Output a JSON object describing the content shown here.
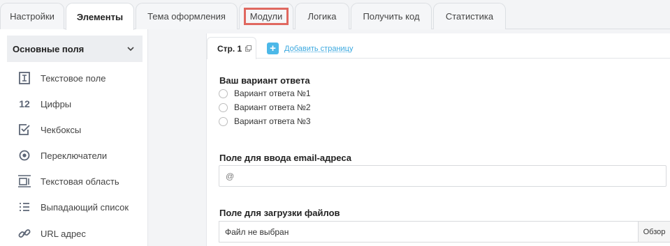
{
  "tabs": [
    {
      "label": "Настройки"
    },
    {
      "label": "Элементы"
    },
    {
      "label": "Тема оформления"
    },
    {
      "label": "Модули"
    },
    {
      "label": "Логика"
    },
    {
      "label": "Получить код"
    },
    {
      "label": "Статистика"
    }
  ],
  "active_tab": "Элементы",
  "highlight_color": "#e06860",
  "sidebar": {
    "section_title": "Основные поля",
    "items": [
      {
        "label": "Текстовое поле",
        "icon": "text-field-icon"
      },
      {
        "label": "Цифры",
        "icon": "numbers-icon",
        "icon_text": "12"
      },
      {
        "label": "Чекбоксы",
        "icon": "checkbox-icon"
      },
      {
        "label": "Переключатели",
        "icon": "radio-icon"
      },
      {
        "label": "Текстовая область",
        "icon": "textarea-icon"
      },
      {
        "label": "Выпадающий список",
        "icon": "list-icon"
      },
      {
        "label": "URL адрес",
        "icon": "link-icon"
      }
    ]
  },
  "page_tabs": {
    "current": "Стр. 1",
    "add_label": "Добавить страницу",
    "accent": "#4cb8e8"
  },
  "form": {
    "q1": {
      "title": "Ваш вариант ответа",
      "options": [
        "Вариант ответа №1",
        "Вариант ответа №2",
        "Вариант ответа №3"
      ]
    },
    "q2": {
      "title": "Поле для ввода email-адреса",
      "placeholder": "@"
    },
    "q3": {
      "title": "Поле для загрузки файлов",
      "file_text": "Файл не выбран",
      "browse": "Обзор"
    }
  }
}
